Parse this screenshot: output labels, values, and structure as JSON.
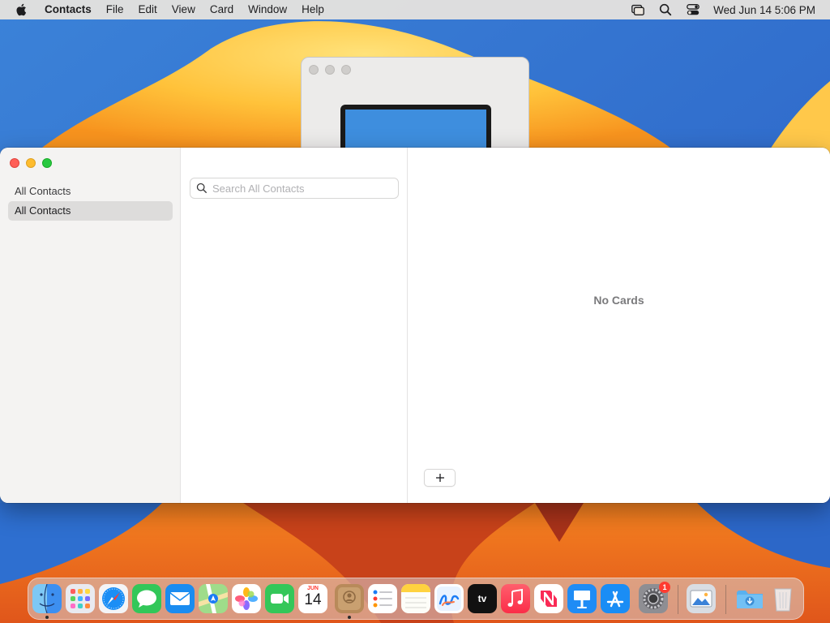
{
  "menubar": {
    "app_name": "Contacts",
    "menus": [
      "File",
      "Edit",
      "View",
      "Card",
      "Window",
      "Help"
    ],
    "status_icons": [
      "screen-mirroring-icon",
      "spotlight-search-icon",
      "control-center-icon"
    ],
    "clock": "Wed Jun 14  5:06 PM"
  },
  "sidebar": {
    "group_header": "All Contacts",
    "selected_group": "All Contacts"
  },
  "search": {
    "placeholder": "Search All Contacts",
    "value": ""
  },
  "card_pane": {
    "empty_text": "No Cards",
    "add_label": "+"
  },
  "dock": {
    "items": [
      "Finder",
      "Launchpad",
      "Safari",
      "Messages",
      "Mail",
      "Maps",
      "Photos",
      "FaceTime",
      "Calendar",
      "Contacts",
      "Reminders",
      "Notes",
      "Freeform",
      "TV",
      "Music",
      "News",
      "Keynote",
      "App Store",
      "System Settings",
      "Preview",
      "Downloads",
      "Trash"
    ],
    "calendar_month": "JUN",
    "calendar_day": "14",
    "tv_label": "tv",
    "settings_badge": "1",
    "running": [
      "Finder",
      "Contacts"
    ]
  },
  "colors": {
    "close": "#ff5f57",
    "minimize": "#febc2e",
    "zoom": "#28c840",
    "selection": "#dddcdb",
    "empty_text": "#7a7a7c"
  }
}
